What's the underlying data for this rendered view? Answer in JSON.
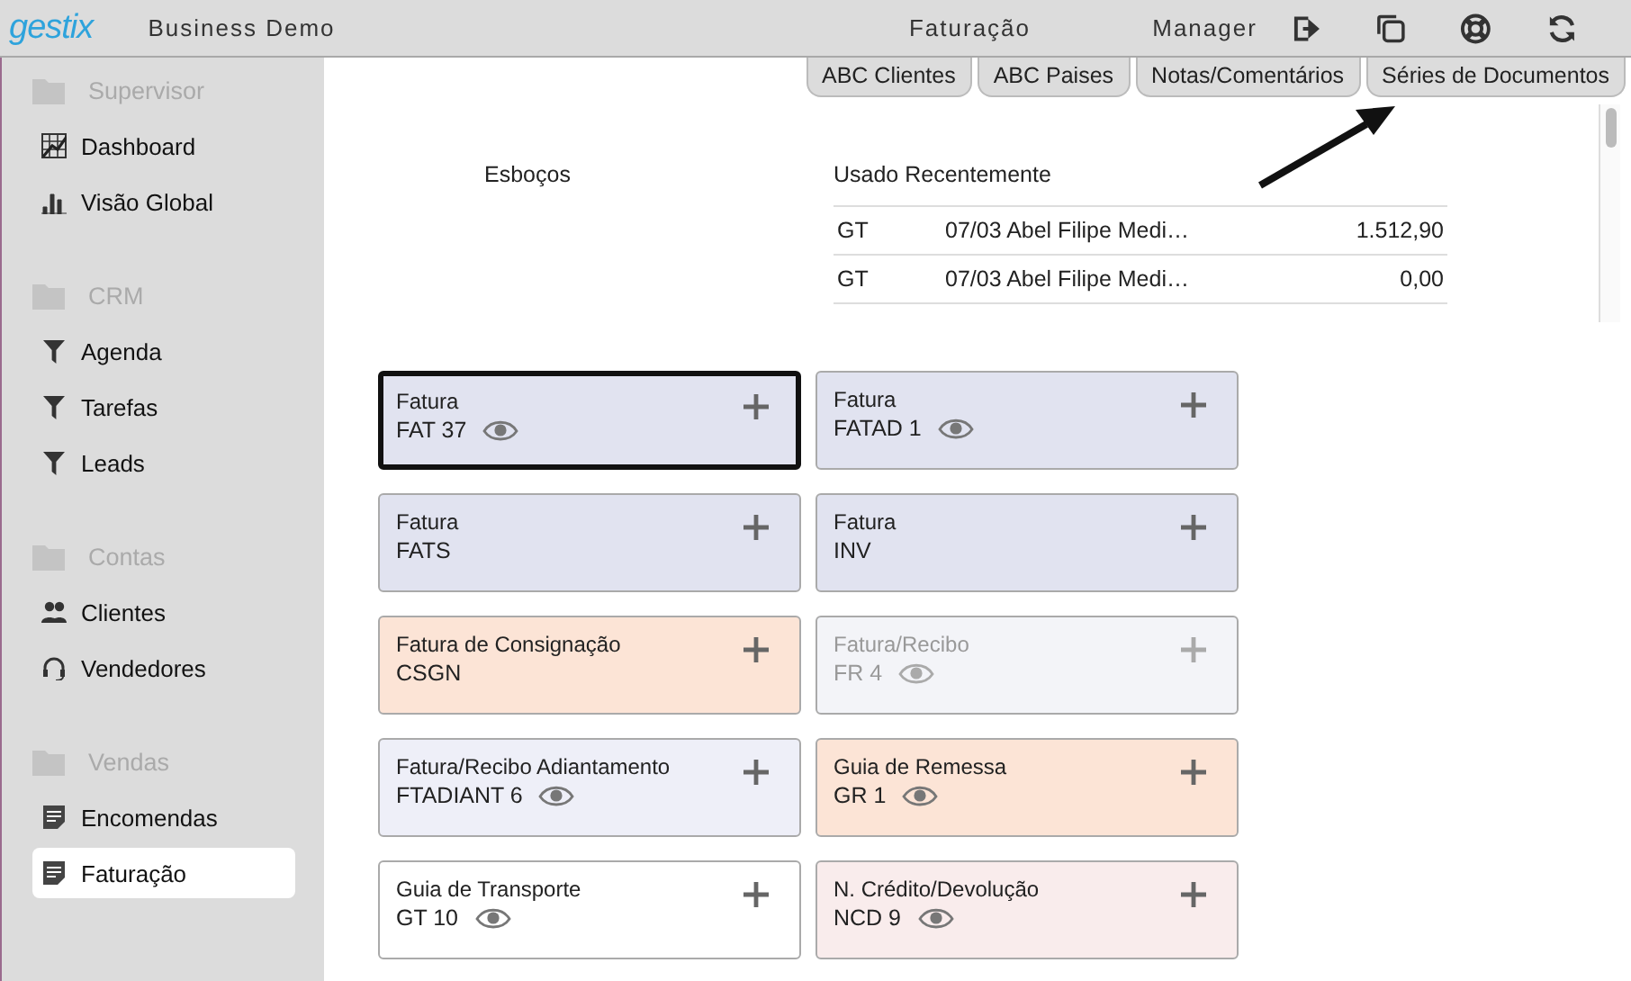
{
  "header": {
    "logo": "gestix",
    "company": "Business Demo",
    "page": "Faturação",
    "user": "Manager"
  },
  "tabs": [
    "ABC Clientes",
    "ABC Paises",
    "Notas/Comentários",
    "Séries de Documentos"
  ],
  "sidebar": {
    "sections": [
      {
        "title": "Supervisor",
        "items": [
          {
            "label": "Dashboard",
            "selected": false
          },
          {
            "label": "Visão Global",
            "selected": false
          }
        ]
      },
      {
        "title": "CRM",
        "items": [
          {
            "label": "Agenda",
            "selected": false
          },
          {
            "label": "Tarefas",
            "selected": false
          },
          {
            "label": "Leads",
            "selected": false
          }
        ]
      },
      {
        "title": "Contas",
        "items": [
          {
            "label": "Clientes",
            "selected": false
          },
          {
            "label": "Vendedores",
            "selected": false
          }
        ]
      },
      {
        "title": "Vendas",
        "items": [
          {
            "label": "Encomendas",
            "selected": false
          },
          {
            "label": "Faturação",
            "selected": true
          }
        ]
      }
    ]
  },
  "drafts": {
    "title": "Esboços"
  },
  "recent": {
    "title": "Usado Recentemente",
    "rows": [
      {
        "type": "GT",
        "description": "07/03 Abel Filipe Medi…",
        "amount": "1.512,90"
      },
      {
        "type": "GT",
        "description": "07/03 Abel Filipe Medi…",
        "amount": "0,00"
      }
    ]
  },
  "series": [
    {
      "name": "Fatura",
      "code": "FAT 37",
      "eye": true,
      "selected": true,
      "disabled": false,
      "color": "#e1e3f0"
    },
    {
      "name": "Fatura",
      "code": "FATAD 1",
      "eye": true,
      "selected": false,
      "disabled": false,
      "color": "#e1e3f0"
    },
    {
      "name": "Fatura",
      "code": "FATS",
      "eye": false,
      "selected": false,
      "disabled": false,
      "color": "#e1e3f0"
    },
    {
      "name": "Fatura",
      "code": "INV",
      "eye": false,
      "selected": false,
      "disabled": false,
      "color": "#e1e3f0"
    },
    {
      "name": "Fatura de Consignação",
      "code": "CSGN",
      "eye": false,
      "selected": false,
      "disabled": false,
      "color": "#fce4d6"
    },
    {
      "name": "Fatura/Recibo",
      "code": "FR 4",
      "eye": true,
      "selected": false,
      "disabled": true,
      "color": "#f3f4f8"
    },
    {
      "name": "Fatura/Recibo Adiantamento",
      "code": "FTADIANT 6",
      "eye": true,
      "selected": false,
      "disabled": false,
      "color": "#eeeff8"
    },
    {
      "name": "Guia de Remessa",
      "code": "GR 1",
      "eye": true,
      "selected": false,
      "disabled": false,
      "color": "#fce4d6"
    },
    {
      "name": "Guia de Transporte",
      "code": "GT 10",
      "eye": true,
      "selected": false,
      "disabled": false,
      "color": "#ffffff"
    },
    {
      "name": "N. Crédito/Devolução",
      "code": "NCD 9",
      "eye": true,
      "selected": false,
      "disabled": false,
      "color": "#f9ecec"
    }
  ]
}
